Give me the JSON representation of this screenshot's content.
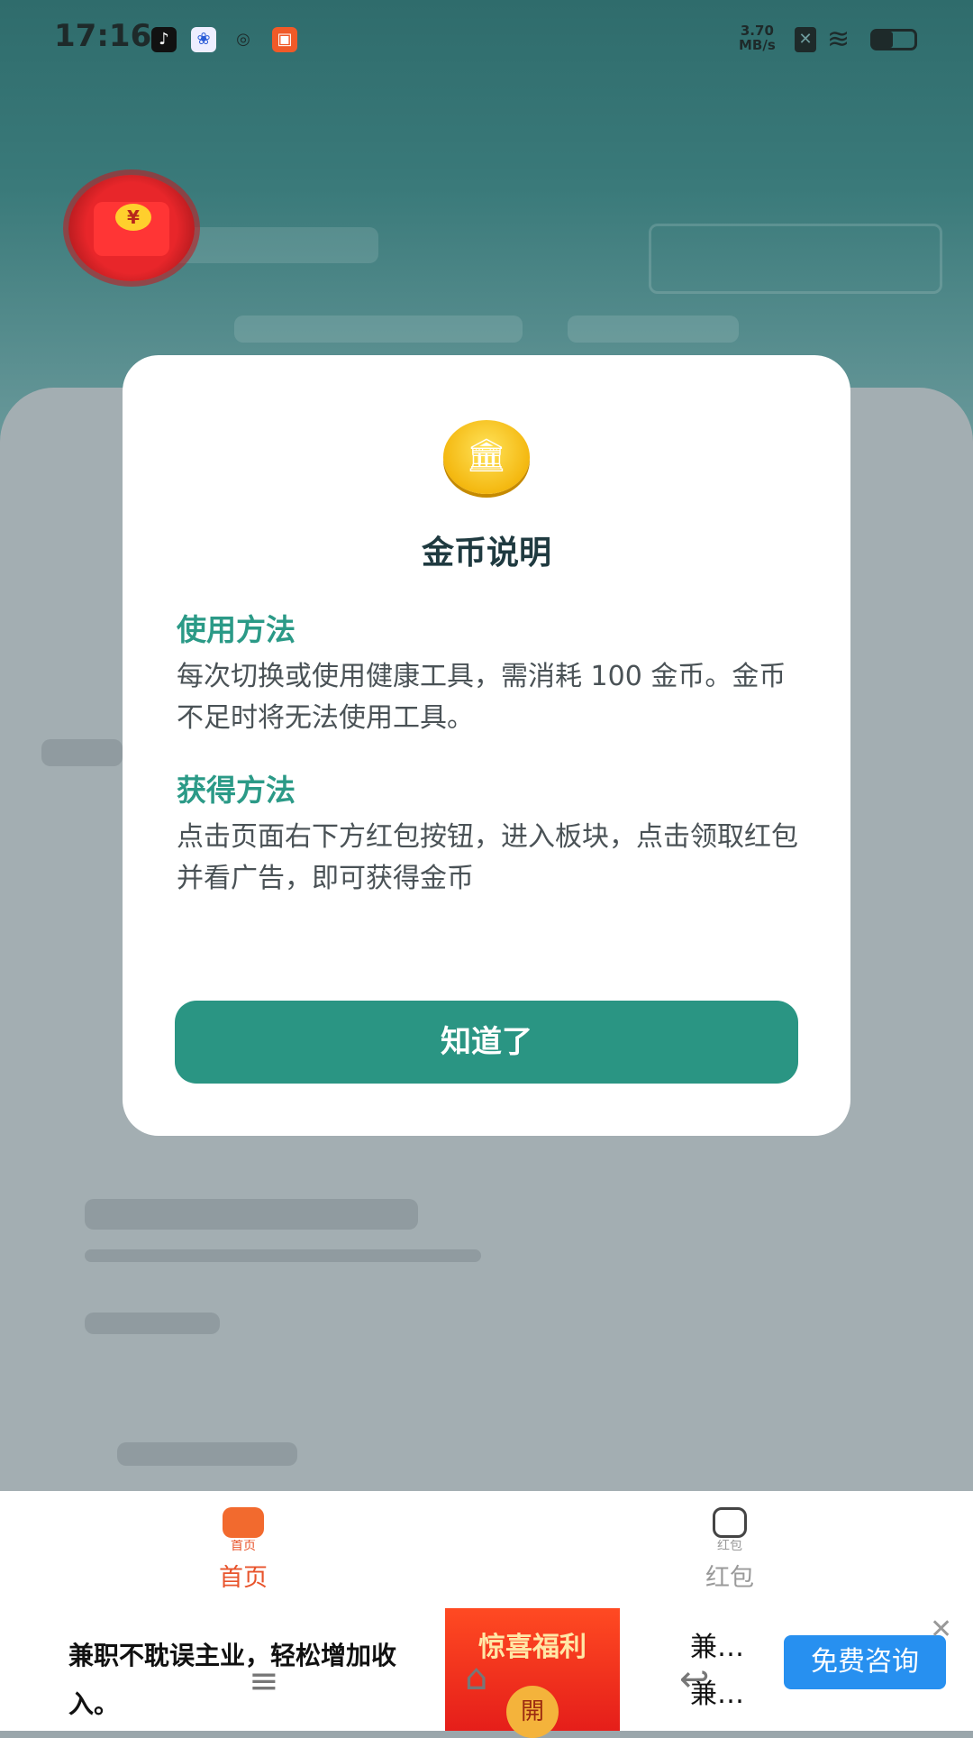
{
  "status_bar": {
    "time": "17:16",
    "net_speed_value": "3.70",
    "net_speed_unit": "MB/s",
    "app_icons": [
      "tiktok-icon",
      "baidu-icon",
      "browser-icon",
      "app-icon"
    ],
    "battery_level": 0.35
  },
  "modal": {
    "title": "金币说明",
    "usage_title": "使用方法",
    "usage_text": "每次切换或使用健康工具，需消耗 100 金币。金币不足时将无法使用工具。",
    "earn_title": "获得方法",
    "earn_text": "点击页面右下方红包按钮，进入板块，点击领取红包并看广告，即可获得金币",
    "confirm_label": "知道了"
  },
  "tabbar": {
    "tabs": [
      {
        "small": "首页",
        "label": "首页",
        "icon": "home-icon",
        "active": true
      },
      {
        "small": "红包",
        "label": "红包",
        "icon": "red-packet-icon",
        "active": false
      }
    ],
    "active_color": "#e8542c",
    "inactive_color": "#9a9a9a"
  },
  "ad": {
    "text": "兼职不耽误主业，轻松增加收入。",
    "promo_text": "惊喜福利",
    "promo_open": "開",
    "right_line1": "兼…",
    "right_line2": "兼…",
    "consult_label": "免费咨询"
  },
  "colors": {
    "accent": "#2a9583",
    "section_title": "#2b9a87"
  }
}
